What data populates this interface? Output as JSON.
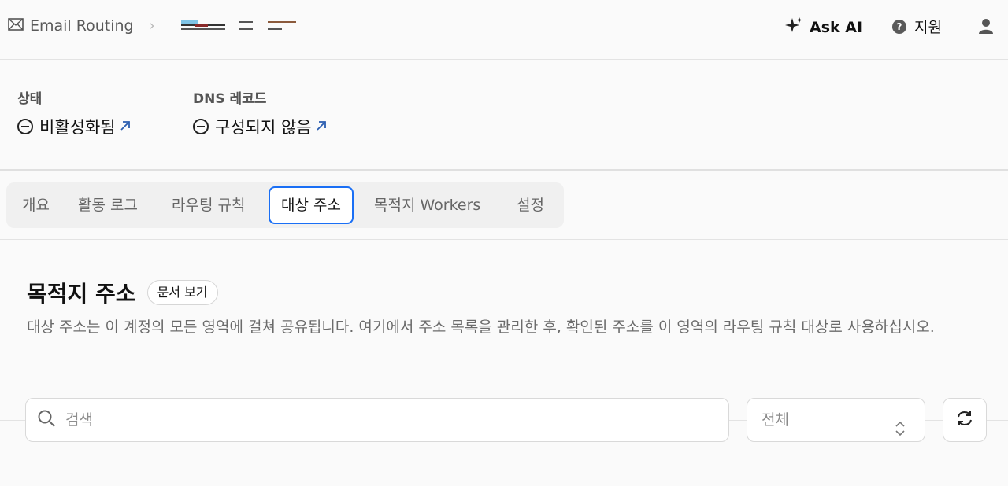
{
  "header": {
    "breadcrumb_root": "Email Routing",
    "ask_ai_label": "Ask AI",
    "support_label": "지원"
  },
  "status": {
    "state_label": "상태",
    "state_value": "비활성화됨",
    "dns_label": "DNS 레코드",
    "dns_value": "구성되지 않음"
  },
  "tabs": [
    {
      "label": "개요"
    },
    {
      "label": "활동 로그"
    },
    {
      "label": "라우팅 규칙"
    },
    {
      "label": "대상 주소",
      "active": true
    },
    {
      "label": "목적지 Workers"
    },
    {
      "label": "설정"
    }
  ],
  "main": {
    "title": "목적지 주소",
    "docs_button": "문서 보기",
    "description": "대상 주소는 이 계정의 모든 영역에 걸쳐 공유됩니다. 여기에서 주소 목록을 관리한 후, 확인된 주소를 이 영역의 라우팅 규칙 대상로 사용하십시오.",
    "search_placeholder": "검색",
    "filter_value": "전체"
  },
  "colors": {
    "accent": "#1a6ff5",
    "link_arrow": "#2a5db0",
    "background": "#fafafa"
  },
  "icons": [
    "envelope-icon",
    "chevron-right-icon",
    "sparkle-icon",
    "help-icon",
    "user-icon",
    "minus-circle-icon",
    "external-link-icon",
    "search-icon",
    "chevron-updown-icon",
    "refresh-icon"
  ]
}
